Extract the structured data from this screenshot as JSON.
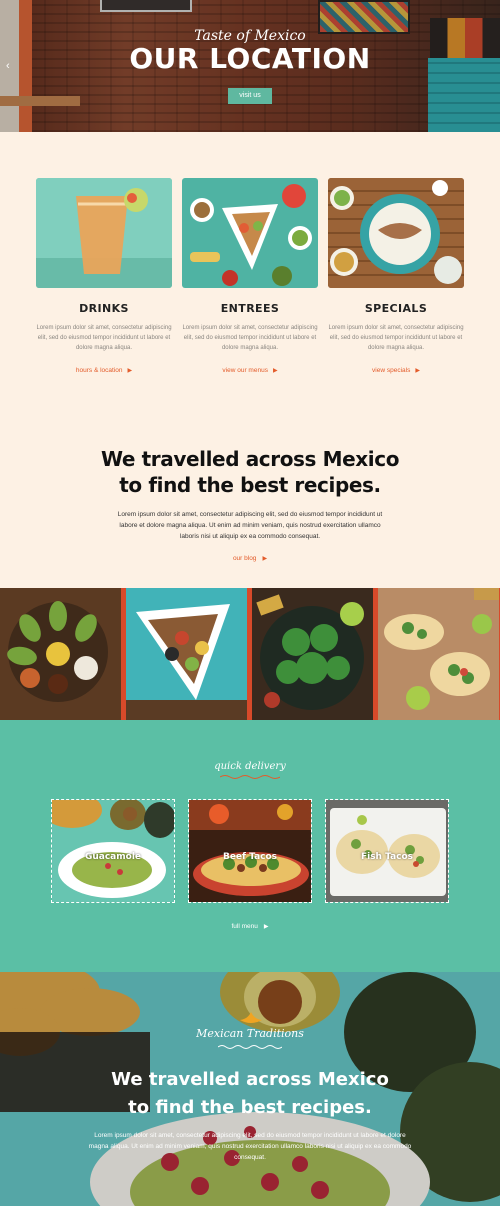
{
  "hero": {
    "subtitle": "Taste of Mexico",
    "title": "OUR LOCATION",
    "button": "visit us",
    "arrow": "‹"
  },
  "features": [
    {
      "title": "DRINKS",
      "text": "Lorem ipsum dolor sit amet, consectetur adipiscing elit, sed do eiusmod tempor incididunt ut labore et dolore magna aliqua.",
      "link": "hours & location"
    },
    {
      "title": "ENTREES",
      "text": "Lorem ipsum dolor sit amet, consectetur adipiscing elit, sed do eiusmod tempor incididunt ut labore et dolore magna aliqua.",
      "link": "view our menus"
    },
    {
      "title": "SPECIALS",
      "text": "Lorem ipsum dolor sit amet, consectetur adipiscing elit, sed do eiusmod tempor incididunt ut labore et dolore magna aliqua.",
      "link": "view specials"
    }
  ],
  "recipes": {
    "title_line1": "We travelled across Mexico",
    "title_line2": "to find the best recipes.",
    "text": "Lorem ipsum dolor sit amet, consectetur adipiscing elit, sed do eiusmod tempor incididunt ut labore et dolore magna aliqua. Ut enim ad minim veniam, quis nostrud exercitation ullamco laboris nisi ut aliquip ex ea commodo consequat.",
    "link": "our blog"
  },
  "delivery": {
    "title": "quick delivery",
    "items": [
      {
        "label": "Guacamole"
      },
      {
        "label": "Beef Tacos"
      },
      {
        "label": "Fish Tacos"
      }
    ],
    "link": "full menu"
  },
  "traditions": {
    "subtitle": "Mexican Traditions",
    "title_line1": "We travelled across Mexico",
    "title_line2": "to find the best recipes.",
    "text": "Lorem ipsum dolor sit amet, consectetur adipiscing elit, sed do eiusmod tempor incididunt ut labore et dolore magna aliqua. Ut enim ad minim veniam, quis nostrud exercitation ullamco laboris nisi ut aliquip ex ea commodo consequat."
  },
  "colors": {
    "accent": "#e35b2a",
    "teal": "#5bbfa5",
    "cream": "#fdf1e4"
  }
}
